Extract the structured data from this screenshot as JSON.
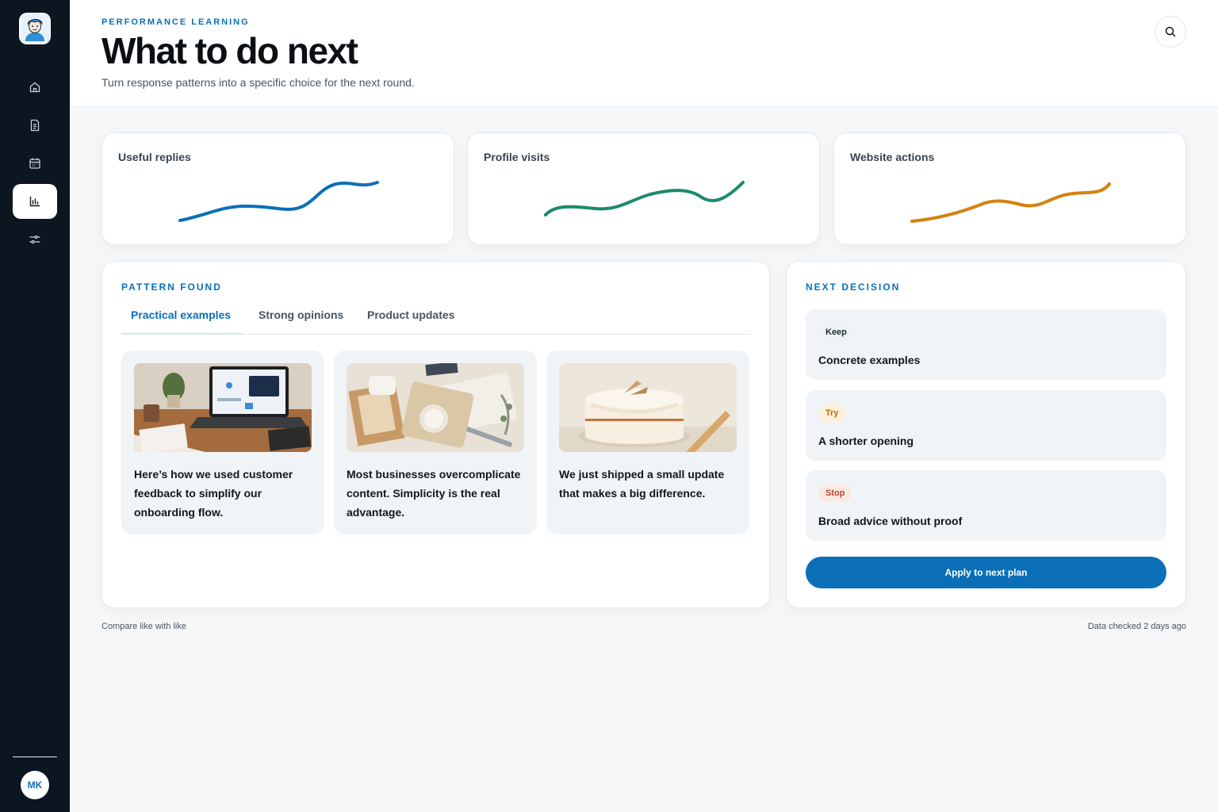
{
  "colors": {
    "accent": "#0b6fb8",
    "sidebar_bg": "#0b1620",
    "series_blue": "#0b6fb8",
    "series_green": "#1b8a6b",
    "series_orange": "#d4820f"
  },
  "sidebar": {
    "items": [
      {
        "icon": "home-icon",
        "active": false
      },
      {
        "icon": "document-icon",
        "active": false
      },
      {
        "icon": "calendar-icon",
        "active": false
      },
      {
        "icon": "bar-chart-icon",
        "active": true
      },
      {
        "icon": "sliders-icon",
        "active": false
      }
    ],
    "avatar_initials": "MK"
  },
  "header": {
    "eyebrow": "PERFORMANCE LEARNING",
    "title": "What to do next",
    "subtitle": "Turn response patterns into a specific choice for the next round."
  },
  "metrics": [
    {
      "label": "Useful replies",
      "color": "#0b6fb8"
    },
    {
      "label": "Profile visits",
      "color": "#1b8a6b"
    },
    {
      "label": "Website actions",
      "color": "#d4820f"
    }
  ],
  "pattern": {
    "eyebrow": "PATTERN FOUND",
    "tabs": [
      "Practical examples",
      "Strong opinions",
      "Product updates"
    ],
    "active_tab": 0,
    "posts": [
      {
        "text": "Here’s how we used customer feedback to simplify our onboarding flow.",
        "image": "laptop-desk-image"
      },
      {
        "text": "Most businesses overcomplicate content. Simplicity is the real advantage.",
        "image": "packaging-flatlay-image"
      },
      {
        "text": "We just shipped a small update that makes a big difference.",
        "image": "cake-image"
      }
    ]
  },
  "decision": {
    "eyebrow": "NEXT DECISION",
    "items": [
      {
        "badge": "Keep",
        "text": "Concrete examples",
        "tone": "keep"
      },
      {
        "badge": "Try",
        "text": "A shorter opening",
        "tone": "try"
      },
      {
        "badge": "Stop",
        "text": "Broad advice without proof",
        "tone": "stop"
      }
    ],
    "apply_label": "Apply to next plan"
  },
  "footer": {
    "left": "Compare like with like",
    "right": "Data checked 2 days ago"
  }
}
